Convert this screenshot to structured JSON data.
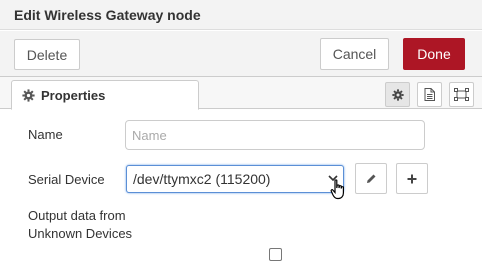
{
  "dialog": {
    "title": "Edit Wireless Gateway node"
  },
  "buttons": {
    "delete": "Delete",
    "cancel": "Cancel",
    "done": "Done",
    "done_color": "#ad1625"
  },
  "tabs": {
    "properties": "Properties",
    "icon_tabs": [
      "gear-icon",
      "description-icon",
      "appearance-icon"
    ]
  },
  "form": {
    "name_label": "Name",
    "name_placeholder": "Name",
    "name_value": "",
    "serial_label": "Serial Device",
    "serial_value": "/dev/ttymxc2 (115200)",
    "unknown_label": "Output data from Unknown Devices",
    "unknown_checked": false
  }
}
